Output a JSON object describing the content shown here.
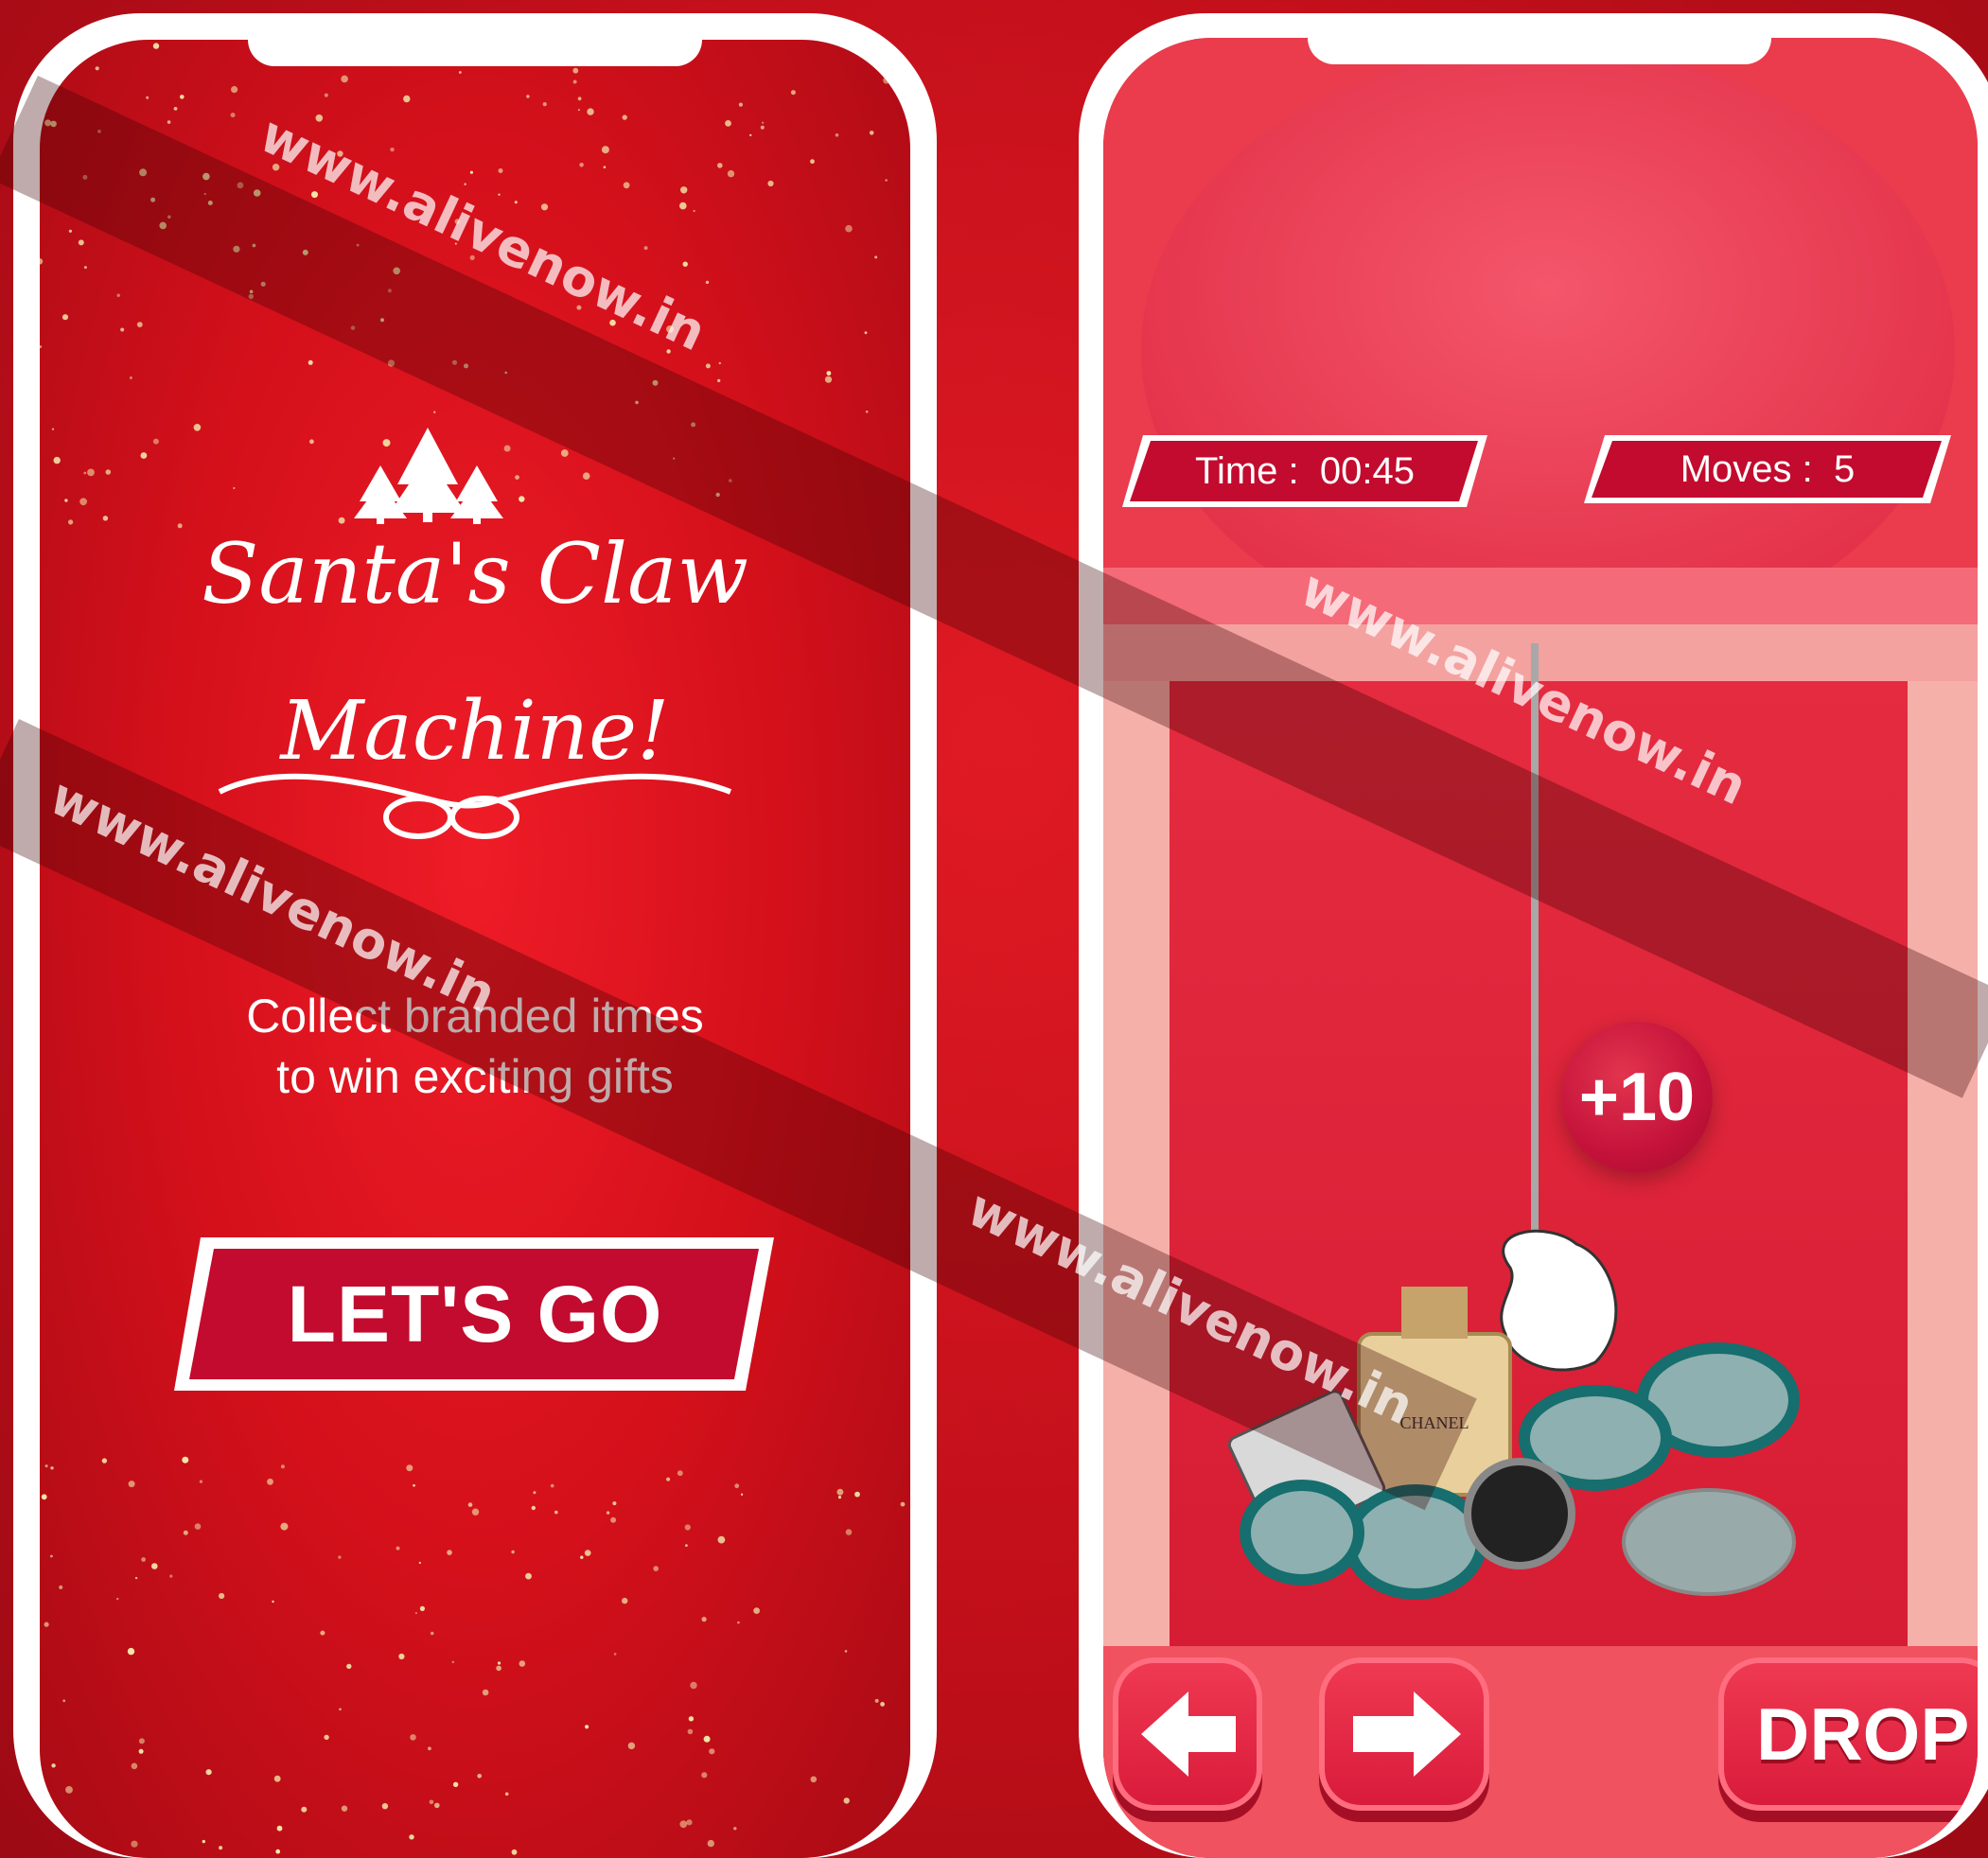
{
  "intro_screen": {
    "title_line1": "Santa's Claw",
    "title_line2": "Machine!",
    "tagline_line1": "Collect branded itmes",
    "tagline_line2": "to win exciting gifts",
    "cta_label": "LET'S GO"
  },
  "game_screen": {
    "time_label": "Time :  00:45",
    "moves_label": "Moves :  5",
    "score_popup": "+10",
    "left_button_icon": "arrow-left-icon",
    "right_button_icon": "arrow-right-icon",
    "drop_label": "DROP",
    "product_label": "CHANEL"
  },
  "watermark_text": "www.alivenow.in",
  "colors": {
    "background_red": "#c10f1a",
    "button_crimson": "#c20b2e",
    "phone_frame": "#ffffff",
    "sparkle_gold": "#f3e7a8"
  }
}
